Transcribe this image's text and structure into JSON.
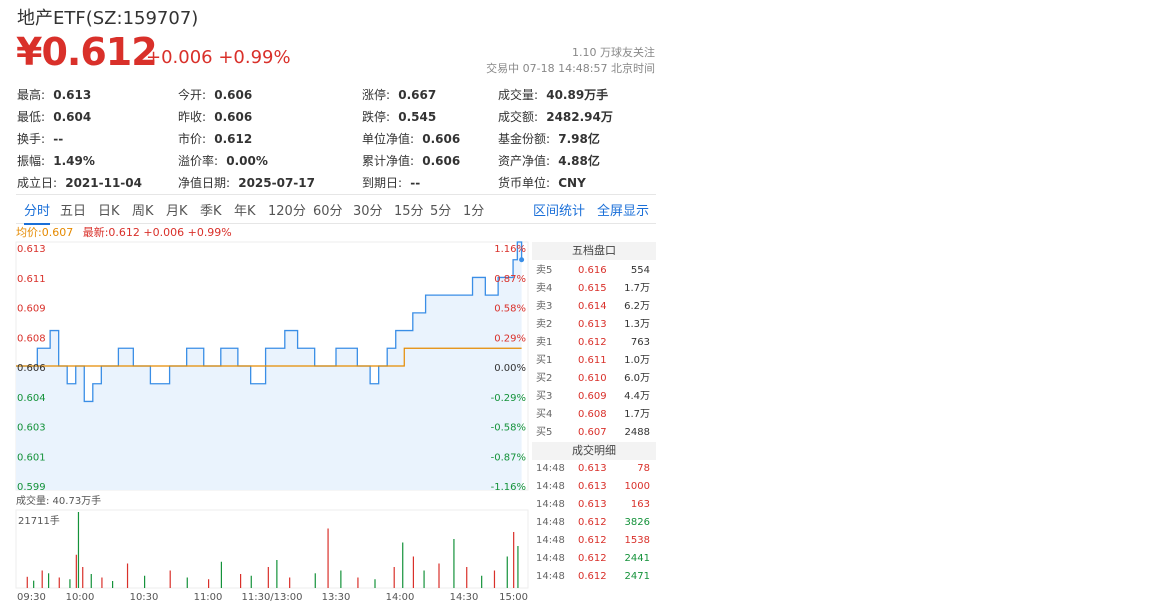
{
  "header": {
    "title": "地产ETF(SZ:159707)",
    "price": "¥0.612",
    "change": "+0.006 +0.99%",
    "followers": "1.10 万球友关注",
    "status": "交易中 07-18 14:48:57 北京时间"
  },
  "quote": [
    [
      {
        "label": "最高:",
        "value": "0.613",
        "color": "red"
      },
      {
        "label": "今开:",
        "value": "0.606",
        "color": ""
      },
      {
        "label": "涨停:",
        "value": "0.667",
        "color": "red"
      },
      {
        "label": "成交量:",
        "value": "40.89万手",
        "color": ""
      }
    ],
    [
      {
        "label": "最低:",
        "value": "0.604",
        "color": "green"
      },
      {
        "label": "昨收:",
        "value": "0.606",
        "color": ""
      },
      {
        "label": "跌停:",
        "value": "0.545",
        "color": "green"
      },
      {
        "label": "成交额:",
        "value": "2482.94万",
        "color": ""
      }
    ],
    [
      {
        "label": "换手:",
        "value": "--",
        "color": ""
      },
      {
        "label": "市价:",
        "value": "0.612",
        "color": ""
      },
      {
        "label": "单位净值:",
        "value": "0.606",
        "color": ""
      },
      {
        "label": "基金份额:",
        "value": "7.98亿",
        "color": ""
      }
    ],
    [
      {
        "label": "振幅:",
        "value": "1.49%",
        "color": ""
      },
      {
        "label": "溢价率:",
        "value": "0.00%",
        "color": ""
      },
      {
        "label": "累计净值:",
        "value": "0.606",
        "color": ""
      },
      {
        "label": "资产净值:",
        "value": "4.88亿",
        "color": ""
      }
    ],
    [
      {
        "label": "成立日:",
        "value": "2021-11-04",
        "color": ""
      },
      {
        "label": "净值日期:",
        "value": "2025-07-17",
        "color": ""
      },
      {
        "label": "到期日:",
        "value": "--",
        "color": ""
      },
      {
        "label": "货币单位:",
        "value": "CNY",
        "color": ""
      }
    ]
  ],
  "tabs": [
    "分时",
    "五日",
    "日K",
    "周K",
    "月K",
    "季K",
    "年K",
    "120分",
    "60分",
    "30分",
    "15分",
    "5分",
    "1分"
  ],
  "active_tab": "分时",
  "tab_actions": [
    "区间统计",
    "全屏显示"
  ],
  "legend": {
    "avg": "均价:0.607",
    "latest": "最新:0.612 +0.006 +0.99%"
  },
  "colors": {
    "up": "#d9302a",
    "down": "#14923a",
    "price_line": "#3a8ee6",
    "avg_line": "#e58a00",
    "accent": "#1a6fd8"
  },
  "chart_data": {
    "type": "line",
    "title": "",
    "price_axis": [
      "0.613",
      "0.611",
      "0.609",
      "0.608",
      "0.606",
      "0.604",
      "0.603",
      "0.601",
      "0.599"
    ],
    "percent_axis": [
      "1.16%",
      "0.87%",
      "0.58%",
      "0.29%",
      "0.00%",
      "-0.29%",
      "-0.58%",
      "-0.87%",
      "-1.16%"
    ],
    "ylim": [
      0.599,
      0.613
    ],
    "prev_close": 0.606,
    "time_labels": [
      "09:30",
      "10:00",
      "10:30",
      "11:00",
      "11:30/13:00",
      "13:30",
      "14:00",
      "14:30",
      "15:00"
    ],
    "series": [
      {
        "name": "最新",
        "points": [
          [
            0,
            0.606
          ],
          [
            5,
            0.606
          ],
          [
            10,
            0.607
          ],
          [
            16,
            0.608
          ],
          [
            20,
            0.606
          ],
          [
            24,
            0.605
          ],
          [
            28,
            0.606
          ],
          [
            32,
            0.604
          ],
          [
            36,
            0.605
          ],
          [
            40,
            0.606
          ],
          [
            48,
            0.607
          ],
          [
            55,
            0.606
          ],
          [
            63,
            0.605
          ],
          [
            72,
            0.606
          ],
          [
            80,
            0.607
          ],
          [
            88,
            0.606
          ],
          [
            96,
            0.607
          ],
          [
            104,
            0.606
          ],
          [
            110,
            0.605
          ],
          [
            117,
            0.607
          ],
          [
            120,
            0.607
          ],
          [
            126,
            0.608
          ],
          [
            132,
            0.607
          ],
          [
            140,
            0.606
          ],
          [
            150,
            0.607
          ],
          [
            160,
            0.606
          ],
          [
            166,
            0.605
          ],
          [
            170,
            0.606
          ],
          [
            174,
            0.607
          ],
          [
            178,
            0.608
          ],
          [
            181,
            0.608
          ],
          [
            186,
            0.609
          ],
          [
            192,
            0.61
          ],
          [
            200,
            0.61
          ],
          [
            208,
            0.61
          ],
          [
            214,
            0.611
          ],
          [
            220,
            0.61
          ],
          [
            226,
            0.611
          ],
          [
            230,
            0.611
          ],
          [
            233,
            0.612
          ],
          [
            235,
            0.613
          ],
          [
            237,
            0.612
          ]
        ]
      },
      {
        "name": "均价",
        "points": [
          [
            0,
            0.606
          ],
          [
            20,
            0.606
          ],
          [
            60,
            0.606
          ],
          [
            175,
            0.606
          ],
          [
            182,
            0.607
          ],
          [
            237,
            0.607
          ]
        ]
      }
    ],
    "volume_label": "成交量: 40.73万手",
    "volume_max_label": "21711手",
    "volume": [
      [
        5,
        3200,
        "up"
      ],
      [
        8,
        2100,
        "down"
      ],
      [
        12,
        5000,
        "up"
      ],
      [
        15,
        4200,
        "down"
      ],
      [
        20,
        3000,
        "up"
      ],
      [
        25,
        2500,
        "down"
      ],
      [
        28,
        9500,
        "up"
      ],
      [
        29,
        21711,
        "down"
      ],
      [
        31,
        6000,
        "up"
      ],
      [
        35,
        4000,
        "down"
      ],
      [
        40,
        3000,
        "up"
      ],
      [
        45,
        2000,
        "down"
      ],
      [
        52,
        7000,
        "up"
      ],
      [
        60,
        3500,
        "down"
      ],
      [
        72,
        5000,
        "up"
      ],
      [
        80,
        3000,
        "down"
      ],
      [
        90,
        2500,
        "up"
      ],
      [
        96,
        7500,
        "down"
      ],
      [
        105,
        4000,
        "up"
      ],
      [
        110,
        3500,
        "down"
      ],
      [
        118,
        6000,
        "up"
      ],
      [
        122,
        8000,
        "down"
      ],
      [
        128,
        3000,
        "up"
      ],
      [
        140,
        4200,
        "down"
      ],
      [
        146,
        17000,
        "up"
      ],
      [
        152,
        5000,
        "down"
      ],
      [
        160,
        3000,
        "up"
      ],
      [
        168,
        2500,
        "down"
      ],
      [
        177,
        6000,
        "up"
      ],
      [
        181,
        13000,
        "down"
      ],
      [
        186,
        9000,
        "up"
      ],
      [
        191,
        5000,
        "down"
      ],
      [
        198,
        7000,
        "up"
      ],
      [
        205,
        14000,
        "down"
      ],
      [
        211,
        6000,
        "up"
      ],
      [
        218,
        3500,
        "down"
      ],
      [
        224,
        5000,
        "up"
      ],
      [
        230,
        9000,
        "down"
      ],
      [
        233,
        16000,
        "up"
      ],
      [
        235,
        12000,
        "down"
      ]
    ]
  },
  "order_book": {
    "title": "五档盘口",
    "asks": [
      {
        "label": "卖5",
        "price": "0.616",
        "volume": "554"
      },
      {
        "label": "卖4",
        "price": "0.615",
        "volume": "1.7万"
      },
      {
        "label": "卖3",
        "price": "0.614",
        "volume": "6.2万"
      },
      {
        "label": "卖2",
        "price": "0.613",
        "volume": "1.3万"
      },
      {
        "label": "卖1",
        "price": "0.612",
        "volume": "763"
      }
    ],
    "bids": [
      {
        "label": "买1",
        "price": "0.611",
        "volume": "1.0万"
      },
      {
        "label": "买2",
        "price": "0.610",
        "volume": "6.0万"
      },
      {
        "label": "买3",
        "price": "0.609",
        "volume": "4.4万"
      },
      {
        "label": "买4",
        "price": "0.608",
        "volume": "1.7万"
      },
      {
        "label": "买5",
        "price": "0.607",
        "volume": "2488"
      }
    ]
  },
  "trades": {
    "title": "成交明细",
    "rows": [
      {
        "time": "14:48",
        "price": "0.613",
        "volume": "78",
        "color": "red"
      },
      {
        "time": "14:48",
        "price": "0.613",
        "volume": "1000",
        "color": "red"
      },
      {
        "time": "14:48",
        "price": "0.613",
        "volume": "163",
        "color": "red"
      },
      {
        "time": "14:48",
        "price": "0.612",
        "volume": "3826",
        "color": "green"
      },
      {
        "time": "14:48",
        "price": "0.612",
        "volume": "1538",
        "color": "red"
      },
      {
        "time": "14:48",
        "price": "0.612",
        "volume": "2441",
        "color": "green"
      },
      {
        "time": "14:48",
        "price": "0.612",
        "volume": "2471",
        "color": "green"
      }
    ]
  }
}
